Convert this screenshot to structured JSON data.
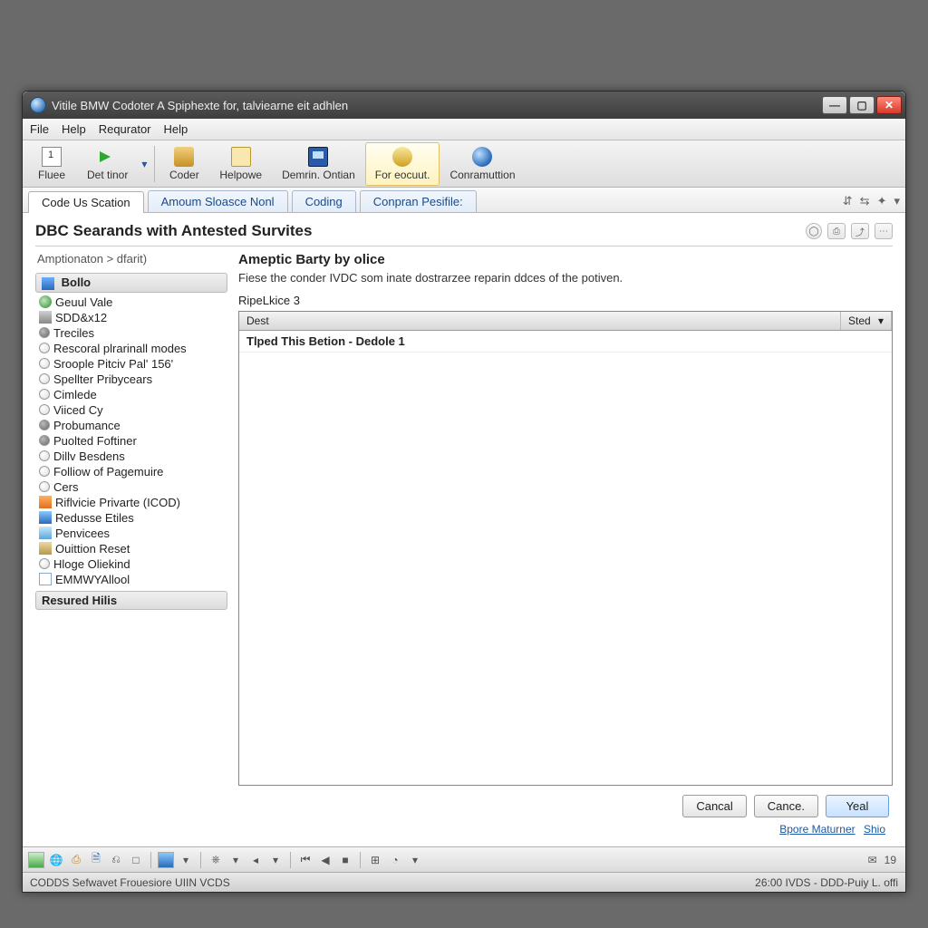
{
  "window": {
    "title": "Vitile BMW Codoter A Spiphexte for, talviearne eit adhlen"
  },
  "menubar": {
    "items": [
      "File",
      "Help",
      "Requrator",
      "Help"
    ]
  },
  "toolbar": {
    "items": [
      {
        "label": "Fluee",
        "icon": "calendar"
      },
      {
        "label": "Det tinor",
        "icon": "arrow-right"
      },
      {
        "label": "Coder",
        "icon": "tools"
      },
      {
        "label": "Helpowe",
        "icon": "folder"
      },
      {
        "label": "Demrin. Ontian",
        "icon": "monitor"
      },
      {
        "label": "For eocuut.",
        "icon": "key",
        "selected": true
      },
      {
        "label": "Conramuttion",
        "icon": "info"
      }
    ]
  },
  "tabs": {
    "items": [
      {
        "label": "Code Us Scation",
        "active": true
      },
      {
        "label": "Amoum Sloasce Nonl"
      },
      {
        "label": "Coding"
      },
      {
        "label": "Conpran Pesifile:"
      }
    ]
  },
  "page": {
    "title": "DBC Searands with Antested Survites",
    "breadcrumb": "Amptionaton > dfarit)",
    "side_header_top": "Bollo",
    "sidebar_items": [
      {
        "label": "Geuul Vale",
        "icon": "globe"
      },
      {
        "label": "SDD&x12",
        "icon": "cube"
      },
      {
        "label": "Treciles",
        "icon": "filled"
      },
      {
        "label": "Rescoral plrarinall modes",
        "icon": "empty"
      },
      {
        "label": "Sroople Pitciv Pal' 156'",
        "icon": "empty"
      },
      {
        "label": "Spellter Pribycears",
        "icon": "empty"
      },
      {
        "label": "Cimlede",
        "icon": "empty"
      },
      {
        "label": "Viiced Cy",
        "icon": "empty"
      },
      {
        "label": "Probumance",
        "icon": "filled"
      },
      {
        "label": "Puolted Foftiner",
        "icon": "filled"
      },
      {
        "label": "Dillv Besdens",
        "icon": "empty"
      },
      {
        "label": "Folliow of Pagemuire",
        "icon": "empty"
      },
      {
        "label": "Cers",
        "icon": "empty"
      },
      {
        "label": "Riflvicie Privarte (ICOD)",
        "icon": "chart"
      },
      {
        "label": "Redusse Etiles",
        "icon": "bar"
      },
      {
        "label": "Penvicees",
        "icon": "gear"
      },
      {
        "label": "Ouittion Reset",
        "icon": "box"
      },
      {
        "label": "Hloge Oliekind",
        "icon": "empty"
      },
      {
        "label": "EMMWYAllool",
        "icon": "doc"
      }
    ],
    "side_header_bottom": "Resured Hilis",
    "main_heading": "Ameptic Barty by olice",
    "main_desc": "Fiese the conder IVDC som inate dostrarzee reparin ddces of the potiven.",
    "sublabel": "RipeLkice 3",
    "grid": {
      "columns": [
        "Dest",
        "Sted"
      ],
      "rows": [
        "Tlped This Betion - Dedole 1"
      ]
    },
    "buttons": {
      "cancel1": "Cancal",
      "cancel2": "Cance.",
      "yes": "Yeal"
    },
    "links": [
      "Bpore Maturner",
      "Shio"
    ]
  },
  "bottombar": {
    "right_num": "19"
  },
  "statusbar": {
    "left": "CODDS Sefwavet Frouesiore UIIN VCDS",
    "right": "26:00 IVDS - DDD-Puiy L. offi"
  },
  "glyphs": {
    "minimize": "—",
    "maximize": "▢",
    "close": "✕",
    "dropdown": "▾",
    "sort": "▾"
  }
}
